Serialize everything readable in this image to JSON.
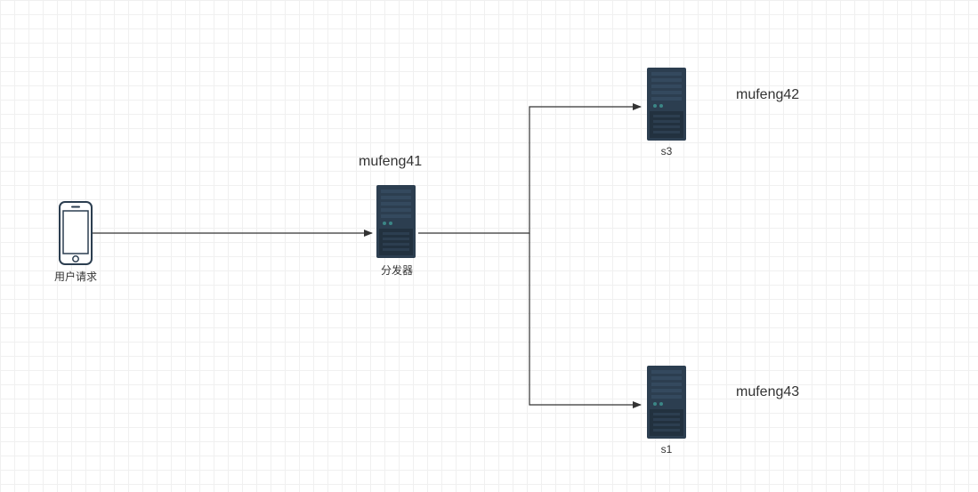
{
  "diagram": {
    "client": {
      "label": "用户请求"
    },
    "dispatcher": {
      "title": "mufeng41",
      "label": "分发器"
    },
    "server_top": {
      "title": "mufeng42",
      "label": "s3"
    },
    "server_bottom": {
      "title": "mufeng43",
      "label": "s1"
    }
  },
  "chart_data": {
    "type": "diagram",
    "title": "",
    "nodes": [
      {
        "id": "client",
        "label": "用户请求",
        "kind": "phone"
      },
      {
        "id": "dispatcher",
        "label": "分发器",
        "title": "mufeng41",
        "kind": "server"
      },
      {
        "id": "s3",
        "label": "s3",
        "title": "mufeng42",
        "kind": "server"
      },
      {
        "id": "s1",
        "label": "s1",
        "title": "mufeng43",
        "kind": "server"
      }
    ],
    "edges": [
      {
        "from": "client",
        "to": "dispatcher",
        "directed": true
      },
      {
        "from": "dispatcher",
        "to": "s3",
        "directed": true
      },
      {
        "from": "dispatcher",
        "to": "s1",
        "directed": true
      }
    ]
  }
}
